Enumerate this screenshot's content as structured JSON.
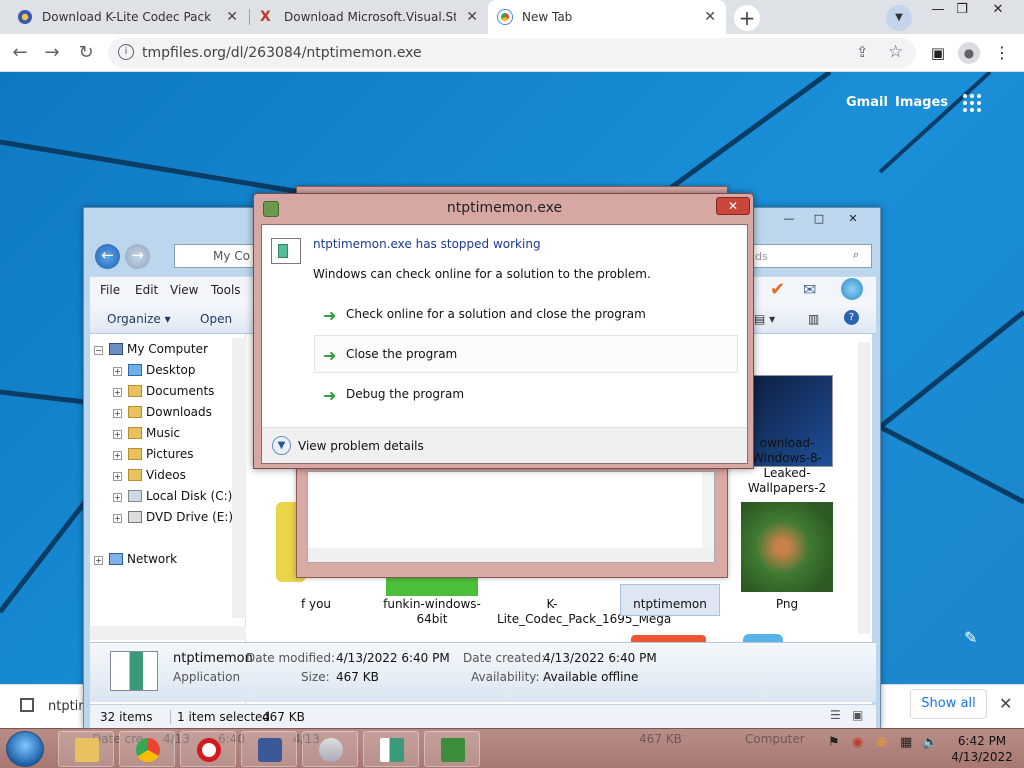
{
  "browser": {
    "tabs": [
      {
        "title": "Download K-Lite Codec Pack Me",
        "active": false
      },
      {
        "title": "Download Microsoft.Visual.Studi",
        "active": false
      },
      {
        "title": "New Tab",
        "active": true
      }
    ],
    "url": "tmpfiles.org/dl/263084/ntptimemon.exe",
    "ntp_links": {
      "gmail": "Gmail",
      "images": "Images"
    }
  },
  "download_bar": {
    "file": "ntptim",
    "show_all": "Show all"
  },
  "explorer": {
    "address": "My Co",
    "search_placeholder": "ds",
    "menu": [
      "File",
      "Edit",
      "View",
      "Tools"
    ],
    "commands": {
      "organize": "Organize ▾",
      "open": "Open"
    },
    "tree": {
      "root": "My Computer",
      "items": [
        "Desktop",
        "Documents",
        "Downloads",
        "Music",
        "Pictures",
        "Videos",
        "Local Disk (C:)",
        "DVD Drive (E:) X"
      ],
      "network": "Network"
    },
    "files": [
      {
        "name": "f you"
      },
      {
        "name": "funkin-windows-64bit"
      },
      {
        "name": "K-Lite_Codec_Pack_1695_Mega"
      },
      {
        "name": "ntptimemon"
      },
      {
        "name": "Png"
      },
      {
        "name": "ownload-Windows-8-Leaked-Wallpapers-2"
      }
    ],
    "details": {
      "name": "ntptimemon",
      "type": "Application",
      "date_modified_label": "Date modified:",
      "date_modified": "4/13/2022 6:40 PM",
      "size_label": "Size:",
      "size": "467 KB",
      "date_created_label": "Date created:",
      "date_created": "4/13/2022 6:40 PM",
      "availability_label": "Availability:",
      "availability": "Available offline"
    },
    "status": {
      "items": "32 items",
      "selected": "1 item selected",
      "selected_size": "467 KB"
    }
  },
  "dialog": {
    "title": "ntptimemon.exe",
    "headline": "ntptimemon.exe has stopped working",
    "subtext": "Windows can check online for a solution to the problem.",
    "options": [
      "Check online for a solution and close the program",
      "Close the program",
      "Debug the program"
    ],
    "details_link": "View problem details"
  },
  "taskbar": {
    "ghost_left": "Date cre",
    "ghost_mid1": "4/13",
    "ghost_mid2": "6:40",
    "ghost_mid3": "4/13",
    "ghost_size": "467 KB",
    "ghost_computer": "Computer",
    "time": "6:42 PM",
    "date": "4/13/2022"
  },
  "colors": {
    "desktop_blue": "#1a7fc8",
    "dialog_frame": "#d6a7a3",
    "close_red": "#c9473a",
    "link_blue": "#1a3b8c",
    "arrow_green": "#2f9f3b"
  }
}
